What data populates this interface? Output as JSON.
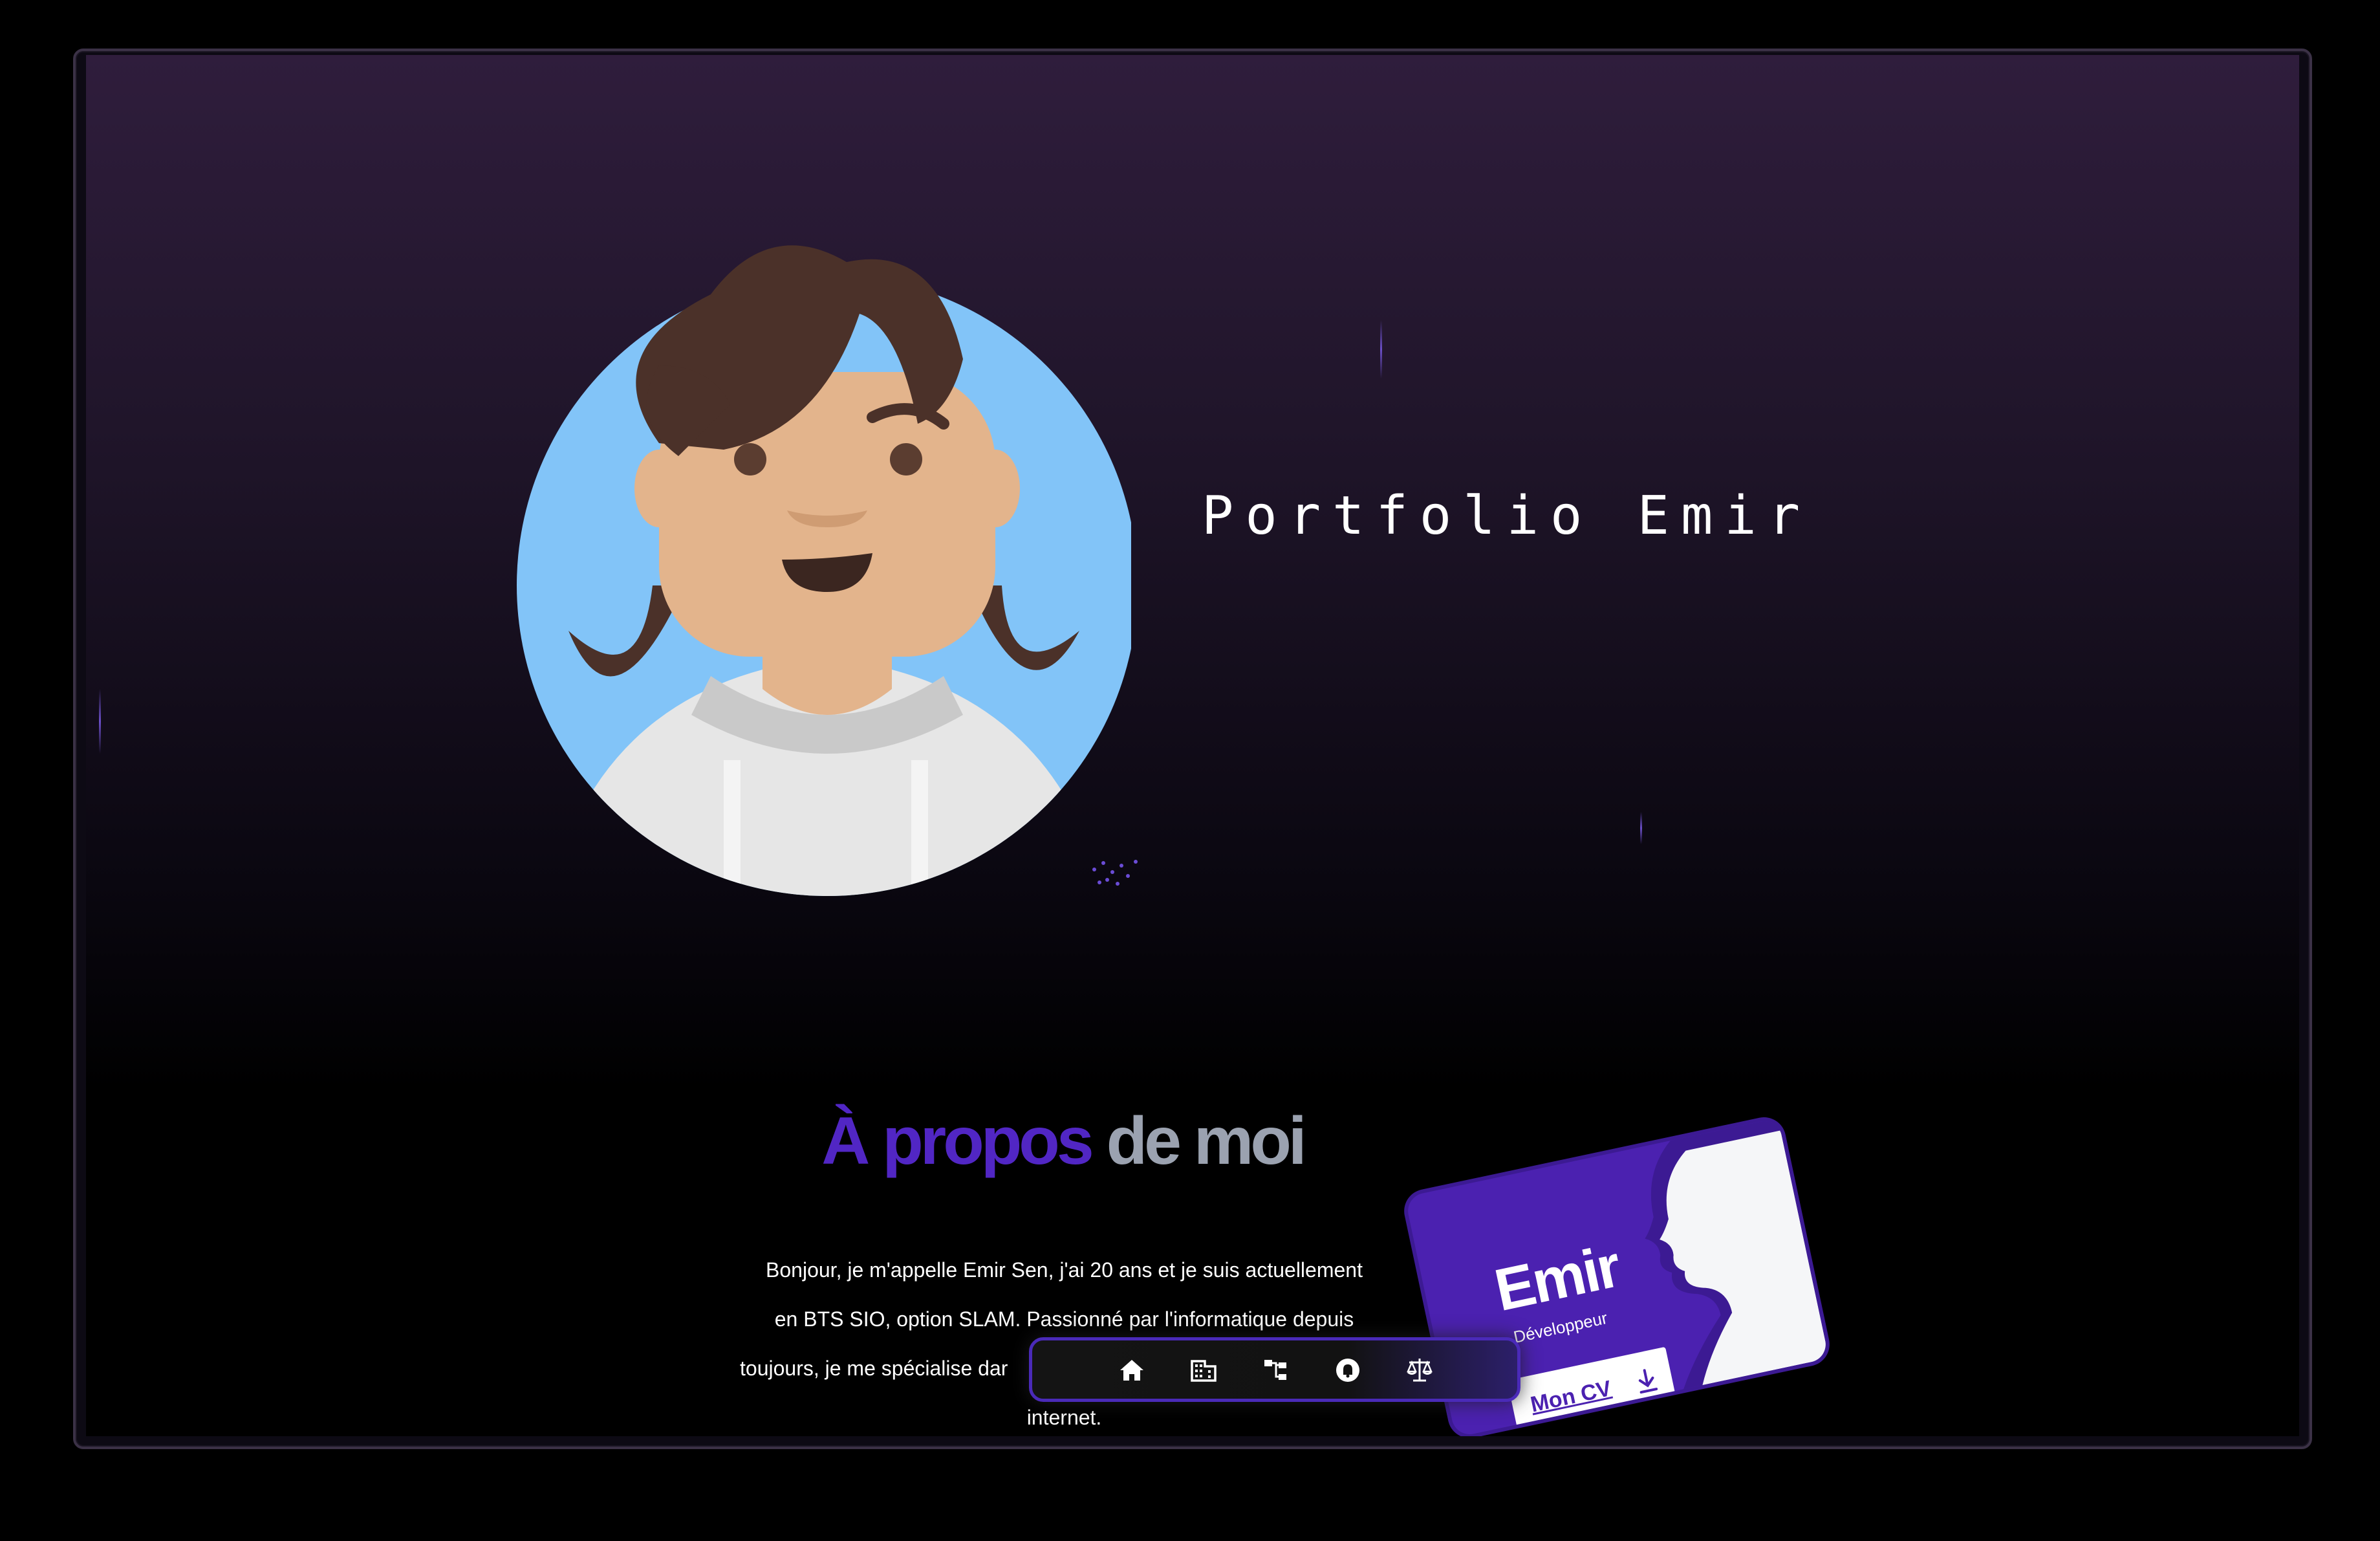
{
  "hero": {
    "title": "Portfolio Emir",
    "avatar_icon": "avatar-illustration"
  },
  "about": {
    "title_accent": "À propos",
    "title_rest": "de moi",
    "line1": "Bonjour, je m'appelle Emir Sen, j'ai 20 ans et je suis actuellement",
    "line2": "en BTS SIO, option SLAM. Passionné par l'informatique depuis",
    "line3": "toujours, je me spécialise dar",
    "line4": "internet."
  },
  "card": {
    "name": "Emir",
    "role": "Développeur",
    "cv_label": "Mon CV",
    "cv_icon": "download-icon"
  },
  "dock": {
    "items": [
      {
        "icon": "home-icon"
      },
      {
        "icon": "building-icon"
      },
      {
        "icon": "sitemap-icon"
      },
      {
        "icon": "bell-icon"
      },
      {
        "icon": "balance-scale-icon"
      }
    ]
  },
  "colors": {
    "accent": "#5126c4",
    "muted": "#9ba2b0",
    "card_bg": "#4b21b0",
    "avatar_bg": "#82c4f8"
  }
}
